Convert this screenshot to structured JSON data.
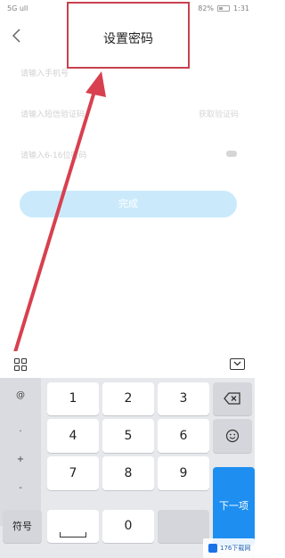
{
  "status_bar": {
    "left": "5G  ull",
    "right": "82%",
    "time": "1:31"
  },
  "header": {
    "title": "设置密码"
  },
  "form": {
    "phone_placeholder": "请输入手机号",
    "code_placeholder": "请输入短信验证码",
    "get_code": "获取验证码",
    "password_placeholder": "请输入6-16位密码"
  },
  "submit": {
    "label": "完成"
  },
  "keyboard": {
    "symbols": [
      "@",
      ".",
      "+",
      "-"
    ],
    "keys": [
      "1",
      "2",
      "3",
      "4",
      "5",
      "6",
      "7",
      "8",
      "9",
      "0"
    ],
    "symbol_switch": "符号",
    "next": "下一项"
  },
  "watermark": "176下载网",
  "colors": {
    "accent": "#1e8ff0",
    "submit_disabled": "#b9e3fb",
    "highlight_box": "#c9414e",
    "arrow": "#d8404f"
  }
}
